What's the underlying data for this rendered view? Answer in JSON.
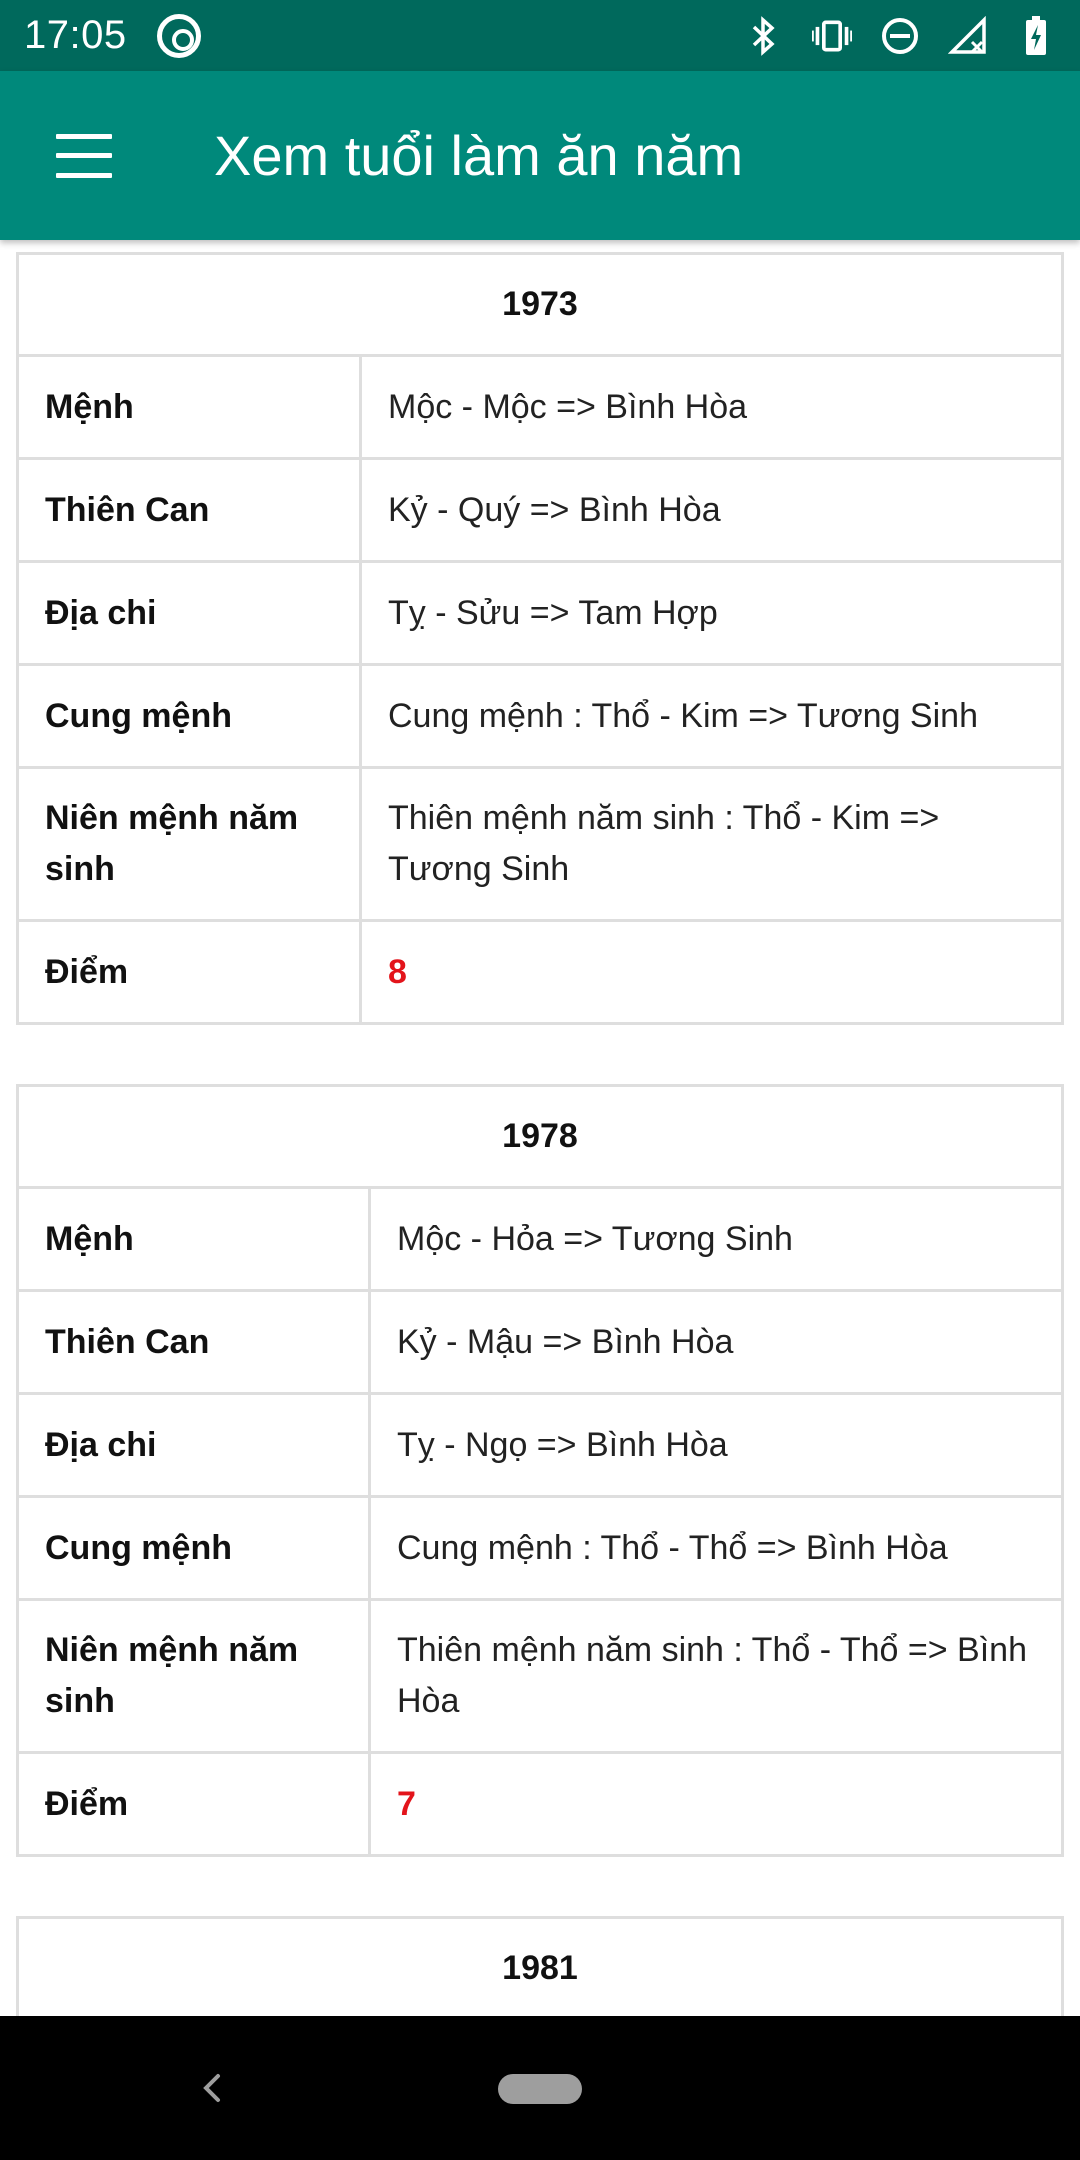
{
  "status_bar": {
    "time": "17:05"
  },
  "app_bar": {
    "title": "Xem tuổi làm ăn năm"
  },
  "labels": {
    "menh": "Mệnh",
    "thien_can": "Thiên Can",
    "dia_chi": "Địa chi",
    "cung_menh": "Cung mệnh",
    "nien_menh": "Niên mệnh năm sinh",
    "diem": "Điểm"
  },
  "cards": [
    {
      "year": "1973",
      "menh": "Mộc - Mộc => Bình Hòa",
      "thien_can": "Kỷ - Quý => Bình Hòa",
      "dia_chi": "Tỵ - Sửu => Tam Hợp",
      "cung_menh": "Cung mệnh : Thổ - Kim => Tương Sinh",
      "nien_menh": "Thiên mệnh năm sinh : Thổ - Kim => Tương Sinh",
      "diem": "8"
    },
    {
      "year": "1978",
      "menh": "Mộc - Hỏa => Tương Sinh",
      "thien_can": "Kỷ - Mậu => Bình Hòa",
      "dia_chi": "Tỵ - Ngọ => Bình Hòa",
      "cung_menh": "Cung mệnh : Thổ - Thổ => Bình Hòa",
      "nien_menh": "Thiên mệnh năm sinh : Thổ - Thổ => Bình Hòa",
      "diem": "7"
    },
    {
      "year": "1981"
    }
  ],
  "colors": {
    "status_bar": "#00695c",
    "app_bar": "#00897b",
    "score": "#e3141b",
    "border": "#dedede"
  }
}
